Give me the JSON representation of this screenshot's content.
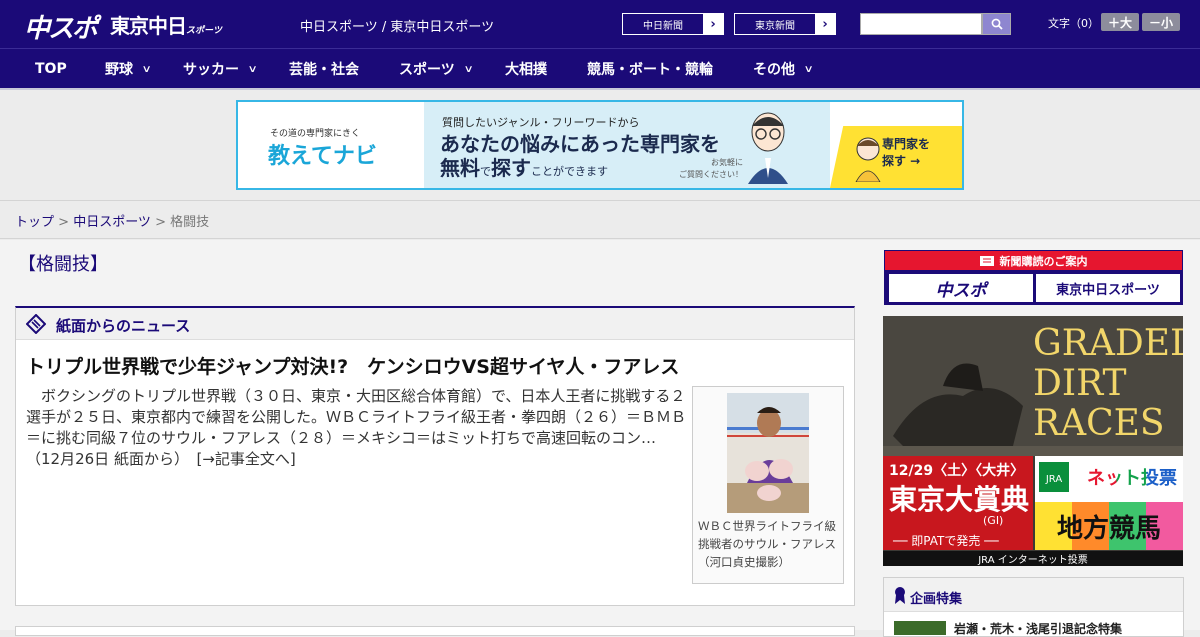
{
  "header": {
    "logo_main": "中スポ",
    "logo_tokyo": "東京中日",
    "logo_tokyo_small": "スポーツ",
    "subtitle": "中日スポーツ / 東京中日スポーツ",
    "site_links": [
      {
        "label": "中日新聞"
      },
      {
        "label": "東京新聞"
      }
    ],
    "search_placeholder": "",
    "font_size_label": "文字（0）",
    "font_bigger": "＋大",
    "font_smaller": "－小"
  },
  "nav": {
    "items": [
      {
        "label": "TOP",
        "has_menu": false
      },
      {
        "label": "野球",
        "has_menu": true
      },
      {
        "label": "サッカー",
        "has_menu": true
      },
      {
        "label": "芸能・社会",
        "has_menu": false
      },
      {
        "label": "スポーツ",
        "has_menu": true
      },
      {
        "label": "大相撲",
        "has_menu": false
      },
      {
        "label": "競馬・ボート・競輪",
        "has_menu": false
      },
      {
        "label": "その他",
        "has_menu": true
      }
    ]
  },
  "banner_ad": {
    "tagline": "その道の専門家にきく",
    "brand": "教えてナビ",
    "line1": "質問したいジャンル・フリーワードから",
    "line2": "あなたの悩みにあった専門家を",
    "line3_a": "無料",
    "line3_b": "で",
    "line3_c": "探す",
    "line3_d": "ことができます",
    "note": "お気軽に\nご質問ください！",
    "cta": "専門家を\n探す →"
  },
  "breadcrumb": {
    "items": [
      "トップ",
      "中日スポーツ",
      "格闘技"
    ],
    "separator": " > "
  },
  "page": {
    "title": "【格闘技】"
  },
  "news_section": {
    "title": "紙面からのニュース",
    "headline": "トリプル世界戦で少年ジャンプ対決!?　ケンシロウVS超サイヤ人・フアレス",
    "body": "　ボクシングのトリプル世界戦（３０日、東京・大田区総合体育館）で、日本人王者に挑戦する２選手が２５日、東京都内で練習を公開した。ＷＢＣライトフライ級王者・拳四朗（２６）＝ＢＭＢ＝に挑む同級７位のサウル・フアレス（２８）＝メキシコ＝はミット打ちで高速回転のコン…（12月26日 紙面から）　[→記事全文へ]",
    "photo_caption": "ＷＢＣ世界ライトフライ級挑戦者のサウル・フアレス（河口貞史撮影）"
  },
  "sidebar": {
    "subscription_title": "新聞購読のご案内",
    "subscription_logos": [
      "中スポ",
      "東京中日スポーツ"
    ],
    "race_ad": {
      "title_lines": [
        "GRADED",
        "DIRT",
        "RACES"
      ],
      "date": "12/29〈土〉〈大井〉",
      "name": "東京大賞典",
      "grade": "(GI)",
      "sale": "── 即PATで発売 ──",
      "right_top": "ネット投票",
      "right_bottom": "地方競馬",
      "footer": "JRA インターネット投票"
    },
    "feature_title": "企画特集",
    "feature_item": "岩瀬・荒木・浅尾引退記念特集"
  },
  "colors": {
    "brand_navy": "#1b0a78",
    "accent_red": "#e6162f",
    "banner_blue": "#37b7e6"
  }
}
